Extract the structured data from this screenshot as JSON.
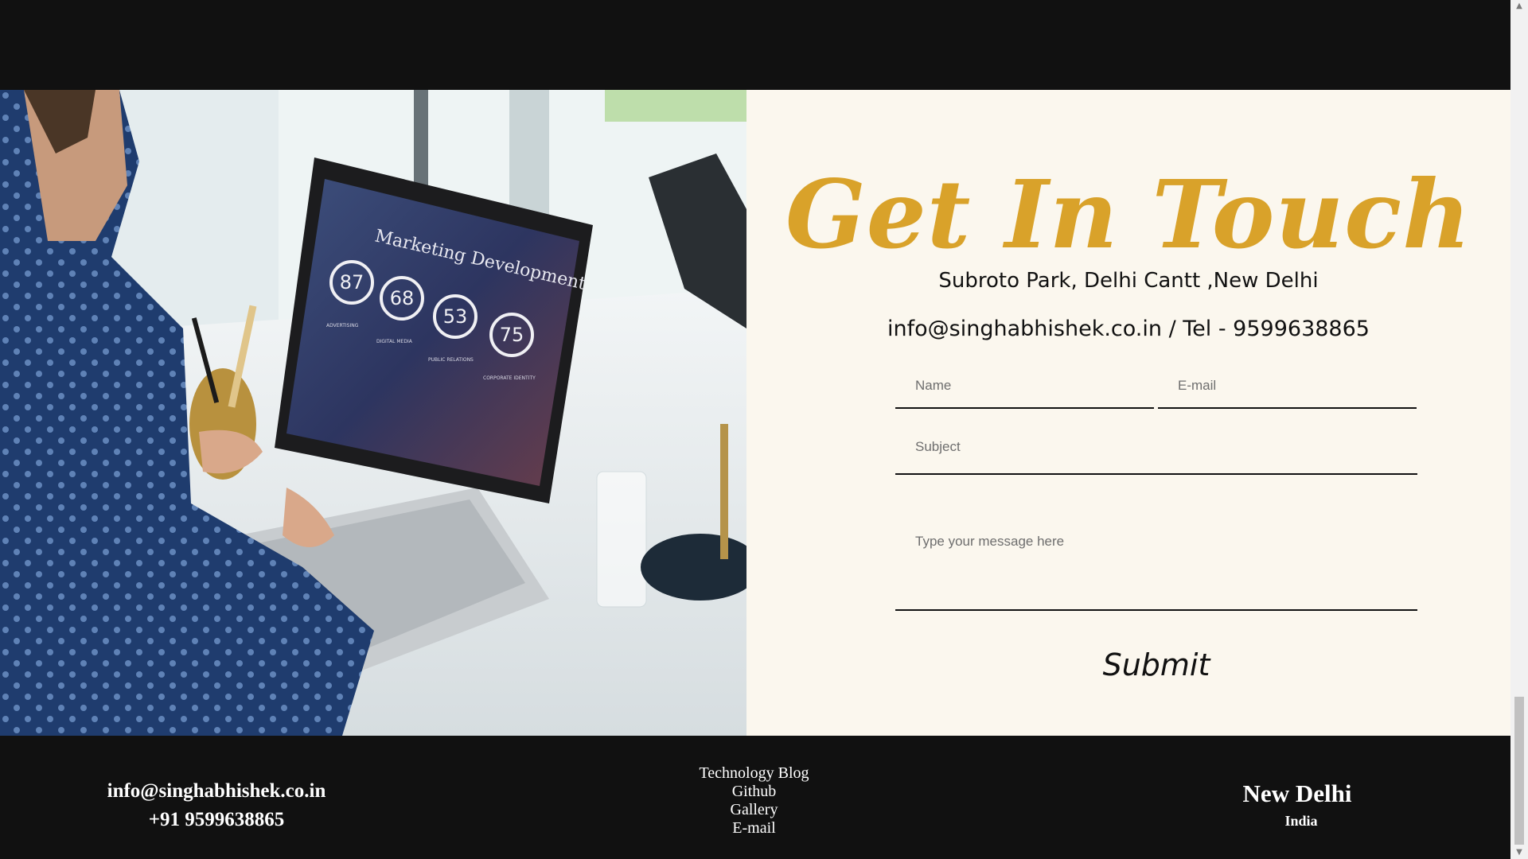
{
  "contact": {
    "heading": "Get In Touch",
    "address": "Subroto Park, Delhi Cantt ,New Delhi",
    "contact_line": "info@singhabhishek.co.in / Tel - 9599638865",
    "name_placeholder": "Name",
    "email_placeholder": "E-mail",
    "subject_placeholder": "Subject",
    "message_placeholder": "Type your message here",
    "submit_label": "Submit"
  },
  "photo": {
    "laptop_title": "Marketing Development",
    "metrics": [
      "87",
      "68",
      "53",
      "75"
    ],
    "metric_captions": [
      "ADVERTISING",
      "DIGITAL MEDIA",
      "PUBLIC RELATIONS",
      "CORPORATE IDENTITY"
    ]
  },
  "footer": {
    "email": "info@singhabhishek.co.in",
    "phone": "+91 9599638865",
    "links": [
      "Technology Blog",
      "Github",
      "Gallery",
      "E-mail"
    ],
    "city": "New Delhi",
    "country": "India"
  }
}
